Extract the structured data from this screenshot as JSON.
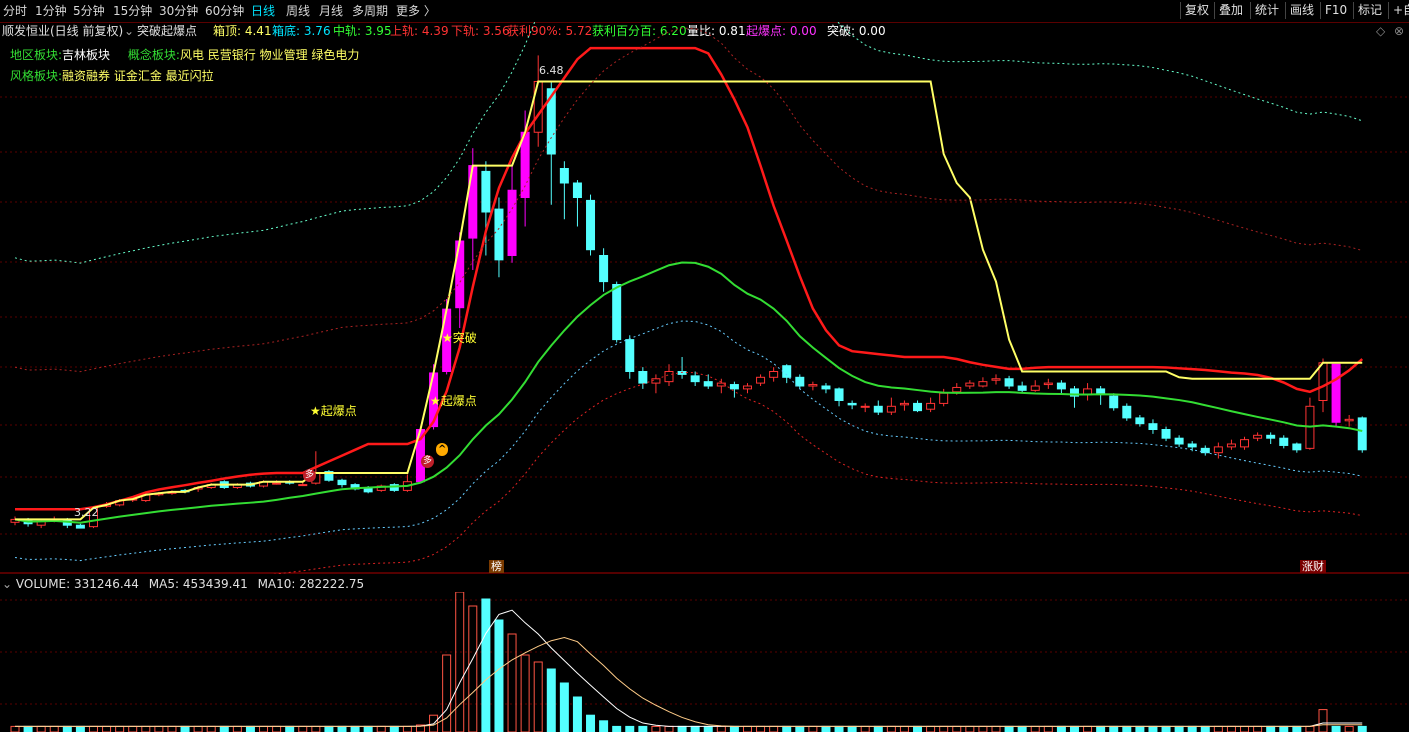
{
  "tabs": [
    {
      "label": "分时"
    },
    {
      "label": "1分钟"
    },
    {
      "label": "5分钟"
    },
    {
      "label": "15分钟"
    },
    {
      "label": "30分钟"
    },
    {
      "label": "60分钟"
    },
    {
      "label": "日线"
    },
    {
      "label": "周线"
    },
    {
      "label": "月线"
    },
    {
      "label": "多周期"
    },
    {
      "label": "更多 〉"
    }
  ],
  "active_tab": "日线",
  "right_buttons": [
    {
      "label": "复权"
    },
    {
      "label": "叠加"
    },
    {
      "label": "统计"
    },
    {
      "label": "画线"
    },
    {
      "label": "F10"
    },
    {
      "label": "标记"
    },
    {
      "label": "+自"
    }
  ],
  "indicator_line": {
    "title": "顺发恒业(日线 前复权)",
    "indicator_name": "突破起爆点",
    "items": [
      {
        "label": "箱顶:",
        "value": "4.41",
        "color": "#ffff66"
      },
      {
        "label": "箱底:",
        "value": "3.76",
        "color": "#00e5ff"
      },
      {
        "label": "中轨:",
        "value": "3.95",
        "color": "#33ff33"
      },
      {
        "label": "上轨:",
        "value": "4.39",
        "color": "#ff3333"
      },
      {
        "label": "下轨:",
        "value": "3.56",
        "color": "#ff3333"
      },
      {
        "label": "获利90%:",
        "value": "5.72",
        "color": "#ff3333"
      },
      {
        "label": "获利百分百:",
        "value": "6.20",
        "color": "#33ff33"
      },
      {
        "label": "量比:",
        "value": "0.81",
        "color": "#ffffff"
      },
      {
        "label": "起爆点:",
        "value": "0.00",
        "color": "#ff33ff"
      },
      {
        "label": "突破:",
        "value": "0.00",
        "color": "#ffffff"
      }
    ]
  },
  "sector_lines": [
    {
      "label": "地区板块:",
      "value": "吉林板块",
      "label2": "概念板块:",
      "value2": "风电 民营银行 物业管理 绿色电力"
    },
    {
      "label": "风格板块:",
      "value": "融资融券 证金汇金 最近闪拉"
    }
  ],
  "annotations": {
    "high": "6.48",
    "low": "3.22",
    "qibao1": "★起爆点",
    "qibao2": "★起爆点",
    "tupo": "★突破",
    "duo1": "多",
    "duo2": "多",
    "bang": "榜",
    "zhangcai": "涨财"
  },
  "volume_line": {
    "label": "VOLUME:",
    "value": "331246.44",
    "ma5_label": "MA5:",
    "ma5": "453439.41",
    "ma10_label": "MA10:",
    "ma10": "282222.75"
  },
  "colors": {
    "up": "#ff3333",
    "down": "#54ffff",
    "limit": "#ff00ff",
    "ma_green": "#33dd33",
    "ma_red": "#ff1a1a",
    "box_top": "#ffff66",
    "grid": "#5a0000"
  },
  "chart_data": {
    "type": "candlestick",
    "candles": [
      [
        3.26,
        3.28,
        3.3,
        3.24
      ],
      [
        3.28,
        3.25,
        3.29,
        3.23
      ],
      [
        3.24,
        3.27,
        3.28,
        3.22
      ],
      [
        3.27,
        3.28,
        3.3,
        3.26
      ],
      [
        3.28,
        3.24,
        3.29,
        3.22
      ],
      [
        3.24,
        3.22,
        3.25,
        3.22
      ],
      [
        3.23,
        3.36,
        3.37,
        3.22
      ],
      [
        3.37,
        3.38,
        3.4,
        3.36
      ],
      [
        3.38,
        3.41,
        3.42,
        3.37
      ],
      [
        3.42,
        3.42,
        3.43,
        3.4
      ],
      [
        3.41,
        3.45,
        3.46,
        3.4
      ],
      [
        3.45,
        3.46,
        3.47,
        3.44
      ],
      [
        3.46,
        3.47,
        3.48,
        3.45
      ],
      [
        3.48,
        3.47,
        3.49,
        3.46
      ],
      [
        3.49,
        3.5,
        3.51,
        3.47
      ],
      [
        3.5,
        3.52,
        3.53,
        3.49
      ],
      [
        3.54,
        3.5,
        3.55,
        3.49
      ],
      [
        3.5,
        3.52,
        3.53,
        3.49
      ],
      [
        3.53,
        3.51,
        3.54,
        3.5
      ],
      [
        3.51,
        3.54,
        3.55,
        3.5
      ],
      [
        3.53,
        3.53,
        3.55,
        3.52
      ],
      [
        3.54,
        3.53,
        3.55,
        3.52
      ],
      [
        3.52,
        3.52,
        3.54,
        3.51
      ],
      [
        3.53,
        3.6,
        3.75,
        3.52
      ],
      [
        3.61,
        3.55,
        3.62,
        3.54
      ],
      [
        3.55,
        3.52,
        3.56,
        3.5
      ],
      [
        3.52,
        3.49,
        3.53,
        3.48
      ],
      [
        3.5,
        3.47,
        3.51,
        3.46
      ],
      [
        3.48,
        3.51,
        3.52,
        3.47
      ],
      [
        3.52,
        3.48,
        3.53,
        3.47
      ],
      [
        3.48,
        3.54,
        3.59,
        3.47
      ],
      [
        3.54,
        3.9,
        3.92,
        3.53
      ],
      [
        3.92,
        4.29,
        4.35,
        3.9
      ],
      [
        4.3,
        4.73,
        4.8,
        4.28
      ],
      [
        4.74,
        5.2,
        5.26,
        4.6
      ],
      [
        5.22,
        5.72,
        5.84,
        5.0
      ],
      [
        5.68,
        5.4,
        5.75,
        5.1
      ],
      [
        5.42,
        5.07,
        5.5,
        4.95
      ],
      [
        5.1,
        5.55,
        5.72,
        5.05
      ],
      [
        5.5,
        5.95,
        6.1,
        5.3
      ],
      [
        5.95,
        6.3,
        6.48,
        5.85
      ],
      [
        6.25,
        5.8,
        6.3,
        5.45
      ],
      [
        5.7,
        5.6,
        5.75,
        5.35
      ],
      [
        5.6,
        5.5,
        5.62,
        5.3
      ],
      [
        5.48,
        5.14,
        5.52,
        5.1
      ],
      [
        5.1,
        4.92,
        5.15,
        4.85
      ],
      [
        4.9,
        4.52,
        4.92,
        4.5
      ],
      [
        4.52,
        4.3,
        4.55,
        4.25
      ],
      [
        4.3,
        4.22,
        4.33,
        4.18
      ],
      [
        4.22,
        4.25,
        4.28,
        4.15
      ],
      [
        4.23,
        4.3,
        4.35,
        4.2
      ],
      [
        4.3,
        4.28,
        4.4,
        4.25
      ],
      [
        4.27,
        4.23,
        4.3,
        4.2
      ],
      [
        4.23,
        4.2,
        4.28,
        4.18
      ],
      [
        4.2,
        4.22,
        4.25,
        4.15
      ],
      [
        4.21,
        4.18,
        4.23,
        4.12
      ],
      [
        4.18,
        4.2,
        4.22,
        4.15
      ],
      [
        4.22,
        4.26,
        4.28,
        4.2
      ],
      [
        4.26,
        4.3,
        4.33,
        4.23
      ],
      [
        4.34,
        4.26,
        4.35,
        4.22
      ],
      [
        4.26,
        4.2,
        4.28,
        4.18
      ],
      [
        4.2,
        4.21,
        4.23,
        4.17
      ],
      [
        4.2,
        4.18,
        4.22,
        4.15
      ],
      [
        4.18,
        4.1,
        4.19,
        4.06
      ],
      [
        4.08,
        4.07,
        4.1,
        4.04
      ],
      [
        4.06,
        4.06,
        4.08,
        4.02
      ],
      [
        4.06,
        4.02,
        4.1,
        4.0
      ],
      [
        4.02,
        4.06,
        4.12,
        4.0
      ],
      [
        4.07,
        4.08,
        4.1,
        4.03
      ],
      [
        4.08,
        4.03,
        4.1,
        4.02
      ],
      [
        4.04,
        4.08,
        4.12,
        4.02
      ],
      [
        4.08,
        4.15,
        4.18,
        4.06
      ],
      [
        4.16,
        4.19,
        4.22,
        4.14
      ],
      [
        4.2,
        4.22,
        4.24,
        4.18
      ],
      [
        4.2,
        4.23,
        4.26,
        4.19
      ],
      [
        4.24,
        4.25,
        4.28,
        4.21
      ],
      [
        4.25,
        4.2,
        4.27,
        4.18
      ],
      [
        4.2,
        4.17,
        4.23,
        4.15
      ],
      [
        4.17,
        4.2,
        4.24,
        4.16
      ],
      [
        4.21,
        4.22,
        4.25,
        4.18
      ],
      [
        4.22,
        4.18,
        4.24,
        4.15
      ],
      [
        4.18,
        4.13,
        4.2,
        4.05
      ],
      [
        4.14,
        4.18,
        4.22,
        4.1
      ],
      [
        4.18,
        4.15,
        4.2,
        4.07
      ],
      [
        4.13,
        4.05,
        4.15,
        4.03
      ],
      [
        4.06,
        3.98,
        4.08,
        3.96
      ],
      [
        3.98,
        3.94,
        4.0,
        3.92
      ],
      [
        3.94,
        3.9,
        3.97,
        3.87
      ],
      [
        3.9,
        3.84,
        3.92,
        3.82
      ],
      [
        3.84,
        3.8,
        3.86,
        3.78
      ],
      [
        3.8,
        3.78,
        3.82,
        3.75
      ],
      [
        3.77,
        3.74,
        3.79,
        3.72
      ],
      [
        3.74,
        3.78,
        3.81,
        3.7
      ],
      [
        3.78,
        3.8,
        3.83,
        3.76
      ],
      [
        3.78,
        3.83,
        3.85,
        3.76
      ],
      [
        3.84,
        3.86,
        3.88,
        3.82
      ],
      [
        3.86,
        3.84,
        3.88,
        3.8
      ],
      [
        3.84,
        3.79,
        3.86,
        3.77
      ],
      [
        3.8,
        3.76,
        3.81,
        3.74
      ],
      [
        3.77,
        4.06,
        4.12,
        3.76
      ],
      [
        4.1,
        4.36,
        4.39,
        4.02
      ],
      [
        4.35,
        3.95,
        4.12,
        3.92
      ],
      [
        3.96,
        3.97,
        4.0,
        3.92
      ],
      [
        3.98,
        3.76,
        3.99,
        3.74
      ]
    ],
    "limit_up_days": [
      31,
      32,
      33,
      34,
      35,
      38,
      39,
      101
    ]
  }
}
